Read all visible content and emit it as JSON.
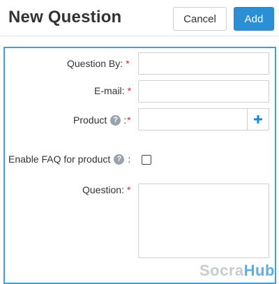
{
  "header": {
    "title": "New Question",
    "cancel_label": "Cancel",
    "add_label": "Add"
  },
  "form": {
    "question_by": {
      "label": "Question By:",
      "required": "*",
      "value": ""
    },
    "email": {
      "label": "E-mail:",
      "required": "*",
      "value": ""
    },
    "product": {
      "label": "Product",
      "help": "?",
      "colon": ":",
      "required": "*",
      "value": ""
    },
    "enable_faq": {
      "label": "Enable FAQ for product",
      "help": "?",
      "colon": ":",
      "checked": false
    },
    "question": {
      "label": "Question:",
      "required": "*",
      "value": ""
    }
  },
  "watermark": {
    "part1": "Socra",
    "part2": "Hub"
  },
  "colors": {
    "accent": "#2b8fd6",
    "panel_border": "#3aa0e0",
    "required": "#d9232d",
    "plus_icon": "#1a8ad4"
  },
  "icons": {
    "help": "question-circle-icon",
    "add_product": "plus-icon"
  }
}
